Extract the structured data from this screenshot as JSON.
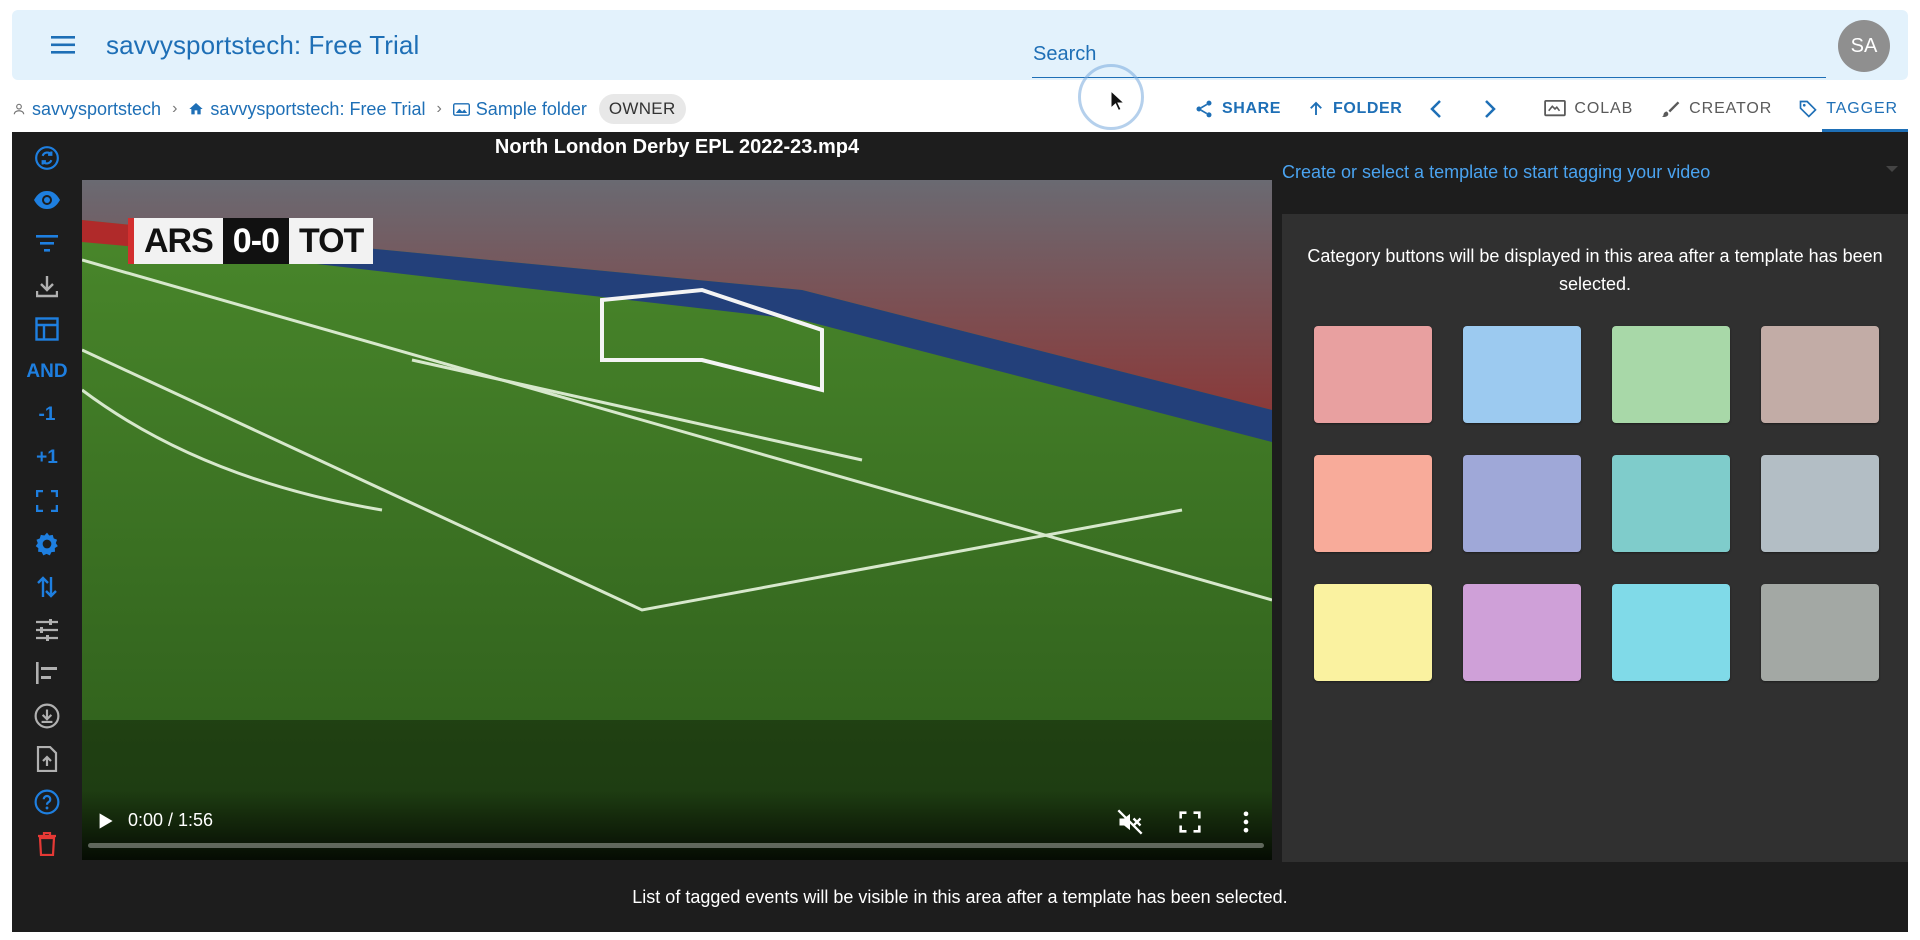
{
  "app": {
    "title": "savvysportstech: Free Trial",
    "search_placeholder": "Search",
    "avatar_initials": "SA"
  },
  "breadcrumb": {
    "items": [
      {
        "label": "savvysportstech",
        "icon": "person-icon"
      },
      {
        "label": "savvysportstech: Free Trial",
        "icon": "home-icon"
      },
      {
        "label": "Sample folder",
        "icon": "folder-image-icon"
      }
    ],
    "role_chip": "OWNER"
  },
  "actions": {
    "share": "SHARE",
    "folder": "FOLDER",
    "colab": "COLAB",
    "creator": "CREATOR",
    "tagger": "TAGGER"
  },
  "sidebar_tools": [
    {
      "name": "sync-icon",
      "label": ""
    },
    {
      "name": "eye-icon",
      "label": ""
    },
    {
      "name": "filter-icon",
      "label": ""
    },
    {
      "name": "download-icon",
      "label": ""
    },
    {
      "name": "table-icon",
      "label": ""
    },
    {
      "name": "and-toggle",
      "label": "AND"
    },
    {
      "name": "minus-one-button",
      "label": "-1"
    },
    {
      "name": "plus-one-button",
      "label": "+1"
    },
    {
      "name": "fullscreen-icon",
      "label": ""
    },
    {
      "name": "settings-icon",
      "label": ""
    },
    {
      "name": "sort-icon",
      "label": ""
    },
    {
      "name": "tune-icon",
      "label": ""
    },
    {
      "name": "align-left-icon",
      "label": ""
    },
    {
      "name": "download-circle-icon",
      "label": ""
    },
    {
      "name": "upload-file-icon",
      "label": ""
    },
    {
      "name": "help-icon",
      "label": ""
    },
    {
      "name": "delete-icon",
      "label": ""
    }
  ],
  "video": {
    "title": "North London Derby EPL 2022-23.mp4",
    "scorebug": {
      "home": "ARS",
      "score": "0-0",
      "away": "TOT"
    },
    "time": "0:00 / 1:56",
    "progress": 0
  },
  "tagger": {
    "template_prompt": "Create or select a template to start tagging your video",
    "category_message": "Category buttons will be displayed in this area after a template has been selected.",
    "swatch_colors": [
      "#e8a0a0",
      "#9ccaf0",
      "#a8d8a8",
      "#c2aca6",
      "#f8ab9a",
      "#9fa8d8",
      "#7fcccb",
      "#b3bec5",
      "#faf2a0",
      "#cfa0d8",
      "#80dae8",
      "#a3a8a4"
    ]
  },
  "events_message": "List of tagged events will be visible in this area after a template has been selected."
}
